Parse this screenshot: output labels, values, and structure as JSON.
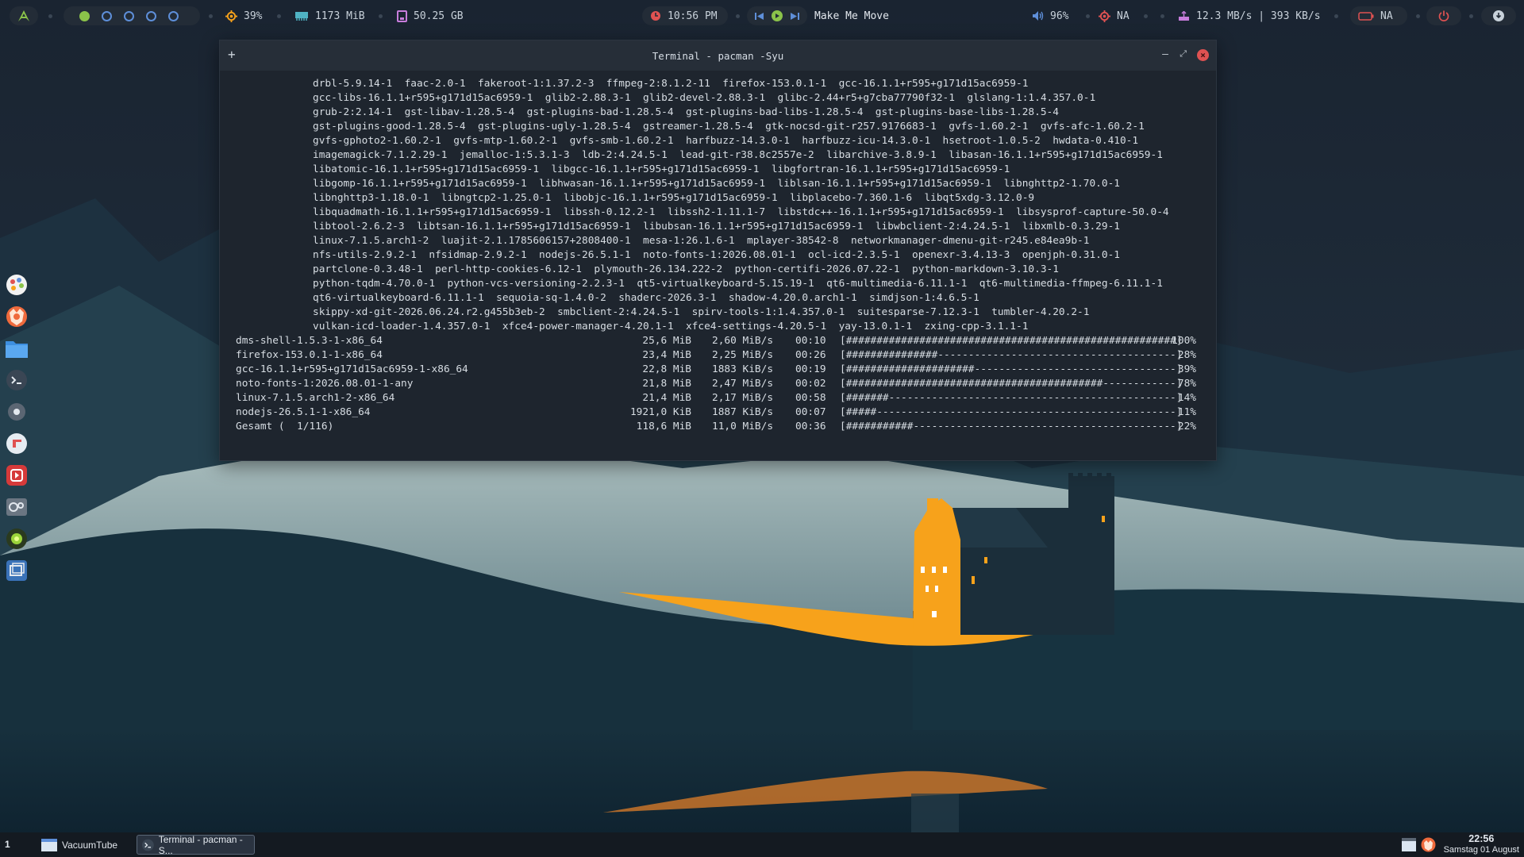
{
  "topbar": {
    "cpu": "39%",
    "memory": "1173 MiB",
    "disk": "50.25 GB",
    "time": "10:56 PM",
    "media_title": "Make Me Move",
    "volume": "96%",
    "temperature": "NA",
    "network": "12.3 MB/s | 393 KB/s",
    "battery": "NA",
    "workspaces": [
      {
        "active": true
      },
      {
        "active": false
      },
      {
        "active": false
      },
      {
        "active": false
      },
      {
        "active": false
      }
    ]
  },
  "terminal": {
    "title": "Terminal - pacman -Syu",
    "add_glyph": "+",
    "package_lines": [
      "drbl-5.9.14-1  faac-2.0-1  fakeroot-1:1.37.2-3  ffmpeg-2:8.1.2-11  firefox-153.0.1-1  gcc-16.1.1+r595+g171d15ac6959-1",
      "gcc-libs-16.1.1+r595+g171d15ac6959-1  glib2-2.88.3-1  glib2-devel-2.88.3-1  glibc-2.44+r5+g7cba77790f32-1  glslang-1:1.4.357.0-1",
      "grub-2:2.14-1  gst-libav-1.28.5-4  gst-plugins-bad-1.28.5-4  gst-plugins-bad-libs-1.28.5-4  gst-plugins-base-libs-1.28.5-4",
      "gst-plugins-good-1.28.5-4  gst-plugins-ugly-1.28.5-4  gstreamer-1.28.5-4  gtk-nocsd-git-r257.9176683-1  gvfs-1.60.2-1  gvfs-afc-1.60.2-1",
      "gvfs-gphoto2-1.60.2-1  gvfs-mtp-1.60.2-1  gvfs-smb-1.60.2-1  harfbuzz-14.3.0-1  harfbuzz-icu-14.3.0-1  hsetroot-1.0.5-2  hwdata-0.410-1",
      "imagemagick-7.1.2.29-1  jemalloc-1:5.3.1-3  ldb-2:4.24.5-1  lead-git-r38.8c2557e-2  libarchive-3.8.9-1  libasan-16.1.1+r595+g171d15ac6959-1",
      "libatomic-16.1.1+r595+g171d15ac6959-1  libgcc-16.1.1+r595+g171d15ac6959-1  libgfortran-16.1.1+r595+g171d15ac6959-1",
      "libgomp-16.1.1+r595+g171d15ac6959-1  libhwasan-16.1.1+r595+g171d15ac6959-1  liblsan-16.1.1+r595+g171d15ac6959-1  libnghttp2-1.70.0-1",
      "libnghttp3-1.18.0-1  libngtcp2-1.25.0-1  libobjc-16.1.1+r595+g171d15ac6959-1  libplacebo-7.360.1-6  libqt5xdg-3.12.0-9",
      "libquadmath-16.1.1+r595+g171d15ac6959-1  libssh-0.12.2-1  libssh2-1.11.1-7  libstdc++-16.1.1+r595+g171d15ac6959-1  libsysprof-capture-50.0-4",
      "libtool-2.6.2-3  libtsan-16.1.1+r595+g171d15ac6959-1  libubsan-16.1.1+r595+g171d15ac6959-1  libwbclient-2:4.24.5-1  libxmlb-0.3.29-1",
      "linux-7.1.5.arch1-2  luajit-2.1.1785606157+2808400-1  mesa-1:26.1.6-1  mplayer-38542-8  networkmanager-dmenu-git-r245.e84ea9b-1",
      "nfs-utils-2.9.2-1  nfsidmap-2.9.2-1  nodejs-26.5.1-1  noto-fonts-1:2026.08.01-1  ocl-icd-2.3.5-1  openexr-3.4.13-3  openjph-0.31.0-1",
      "partclone-0.3.48-1  perl-http-cookies-6.12-1  plymouth-26.134.222-2  python-certifi-2026.07.22-1  python-markdown-3.10.3-1",
      "python-tqdm-4.70.0-1  python-vcs-versioning-2.2.3-1  qt5-virtualkeyboard-5.15.19-1  qt6-multimedia-6.11.1-1  qt6-multimedia-ffmpeg-6.11.1-1",
      "qt6-virtualkeyboard-6.11.1-1  sequoia-sq-1.4.0-2  shaderc-2026.3-1  shadow-4.20.0.arch1-1  simdjson-1:4.6.5-1",
      "skippy-xd-git-2026.06.24.r2.g455b3eb-2  smbclient-2:4.24.5-1  spirv-tools-1:1.4.357.0-1  suitesparse-7.12.3-1  tumbler-4.20.2-1",
      "vulkan-icd-loader-1.4.357.0-1  xfce4-power-manager-4.20.1-1  xfce4-settings-4.20.5-1  yay-13.0.1-1  zxing-cpp-3.1.1-1"
    ],
    "downloads": [
      {
        "name": "dms-shell-1.5.3-1-x86_64",
        "size": "25,6 MiB",
        "rate": "2,60 MiB/s",
        "time": "00:10",
        "bar": "[######################################################]",
        "pct": "100%"
      },
      {
        "name": "firefox-153.0.1-1-x86_64",
        "size": "23,4 MiB",
        "rate": "2,25 MiB/s",
        "time": "00:26",
        "bar": "[###############---------------------------------------]",
        "pct": "28%"
      },
      {
        "name": "gcc-16.1.1+r595+g171d15ac6959-1-x86_64",
        "size": "22,8 MiB",
        "rate": "1883 KiB/s",
        "time": "00:19",
        "bar": "[#####################---------------------------------]",
        "pct": "39%"
      },
      {
        "name": "noto-fonts-1:2026.08.01-1-any",
        "size": "21,8 MiB",
        "rate": "2,47 MiB/s",
        "time": "00:02",
        "bar": "[##########################################------------]",
        "pct": "78%"
      },
      {
        "name": "linux-7.1.5.arch1-2-x86_64",
        "size": "21,4 MiB",
        "rate": "2,17 MiB/s",
        "time": "00:58",
        "bar": "[#######-----------------------------------------------]",
        "pct": "14%"
      },
      {
        "name": "nodejs-26.5.1-1-x86_64",
        "size": "1921,0 KiB",
        "rate": "1887 KiB/s",
        "time": "00:07",
        "bar": "[#####-------------------------------------------------]",
        "pct": "11%"
      },
      {
        "name": "Gesamt (  1/116)",
        "size": "118,6 MiB",
        "rate": "11,0 MiB/s",
        "time": "00:36",
        "bar": "[###########-------------------------------------------]",
        "pct": "22%"
      }
    ]
  },
  "taskbar": {
    "workspace": "1",
    "tasks": [
      {
        "label": "VacuumTube",
        "active": false
      },
      {
        "label": "Terminal - pacman -S...",
        "active": true
      }
    ],
    "clock_time": "22:56",
    "clock_date": "Samstag 01 August"
  },
  "dock": {
    "items": [
      "palette-icon",
      "firefox-icon",
      "folder-icon",
      "terminal-icon",
      "settings-icon",
      "chat-icon",
      "media-player-icon",
      "system-settings-icon",
      "green-orb-icon",
      "window-icon"
    ]
  },
  "colors": {
    "accent_orange": "#f7a21b",
    "terminal_bg": "#1e252e",
    "close_red": "#e05252",
    "workspace_active": "#8bc34a",
    "workspace_ring": "#5e8fd9"
  }
}
